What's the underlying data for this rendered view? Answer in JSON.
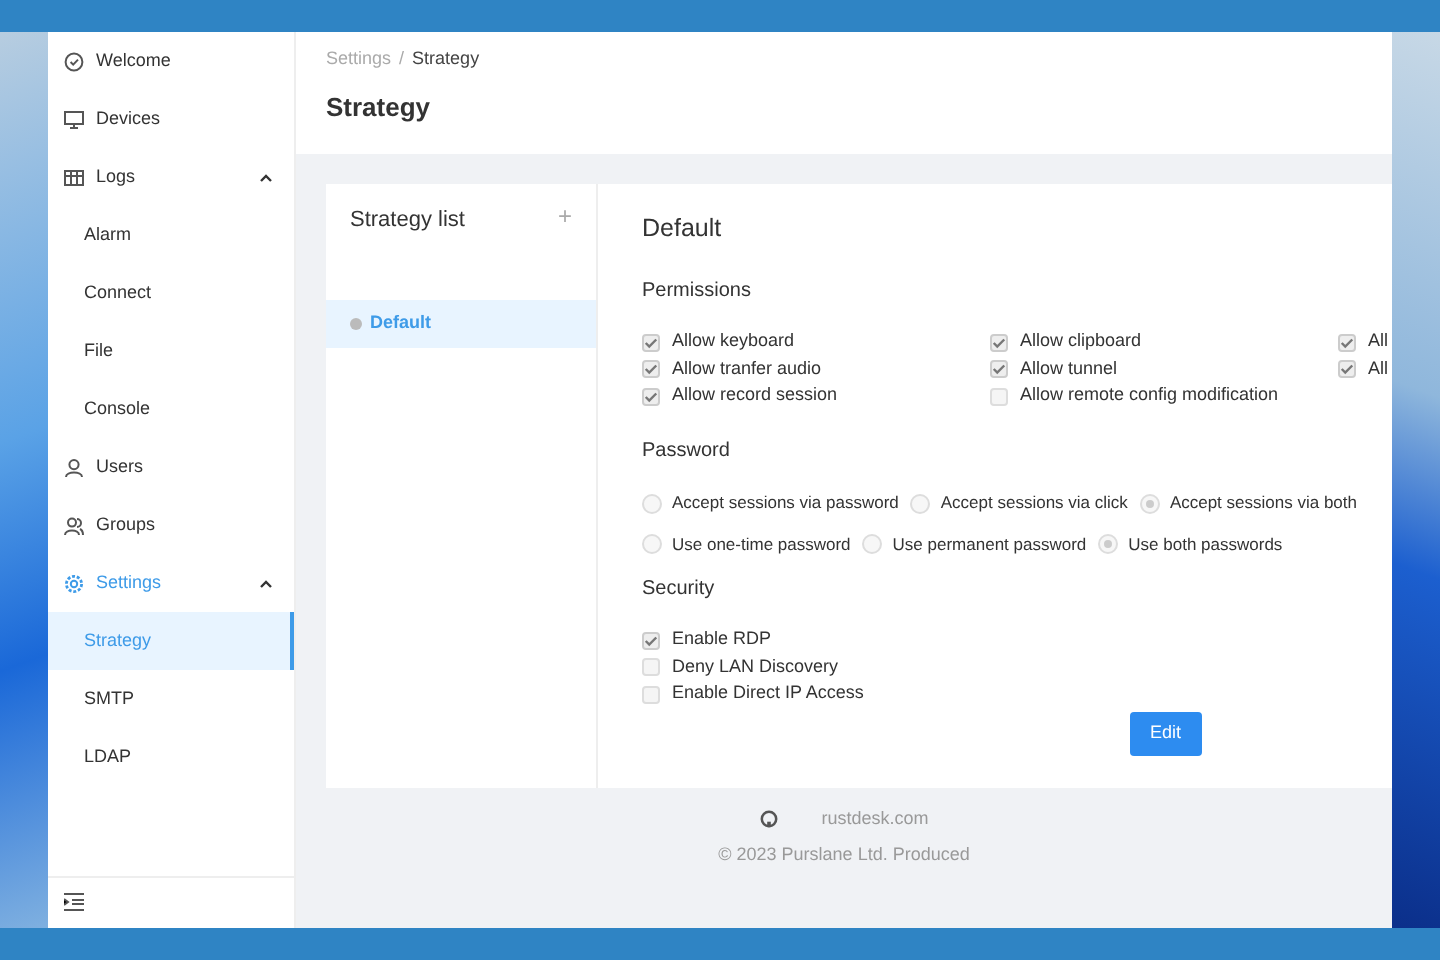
{
  "sidebar": {
    "items": [
      {
        "label": "Welcome",
        "selected": false
      },
      {
        "label": "Devices",
        "selected": false
      },
      {
        "label": "Logs",
        "selected": false,
        "expanded": true,
        "children": [
          {
            "label": "Alarm",
            "selected": false
          },
          {
            "label": "Connect",
            "selected": false
          },
          {
            "label": "File",
            "selected": false
          },
          {
            "label": "Console",
            "selected": false
          }
        ]
      },
      {
        "label": "Users",
        "selected": false
      },
      {
        "label": "Groups",
        "selected": false
      },
      {
        "label": "Settings",
        "selected": true,
        "expanded": true,
        "children": [
          {
            "label": "Strategy",
            "selected": true
          },
          {
            "label": "SMTP",
            "selected": false
          },
          {
            "label": "LDAP",
            "selected": false
          }
        ]
      }
    ]
  },
  "breadcrumb": [
    {
      "label": "Settings",
      "current": false
    },
    {
      "label": "Strategy",
      "current": true
    }
  ],
  "breadcrumb_separator": "/",
  "page_title": "Strategy",
  "strategy_list": {
    "title": "Strategy list",
    "add_icon": "+",
    "items": [
      {
        "label": "Default",
        "selected": true
      }
    ]
  },
  "strategy": {
    "title": "Default",
    "permissions": {
      "title": "Permissions",
      "columns": [
        [
          {
            "label": "Allow keyboard",
            "checked": true
          },
          {
            "label": "Allow tranfer audio",
            "checked": true
          },
          {
            "label": "Allow record session",
            "checked": true
          }
        ],
        [
          {
            "label": "Allow clipboard",
            "checked": true
          },
          {
            "label": "Allow tunnel",
            "checked": true
          },
          {
            "label": "Allow remote config modification",
            "checked": false
          }
        ],
        [
          {
            "label": "All",
            "checked": true
          },
          {
            "label": "All",
            "checked": true
          }
        ]
      ]
    },
    "password": {
      "title": "Password",
      "groups": [
        [
          {
            "label": "Accept sessions via password",
            "selected": false
          },
          {
            "label": "Accept sessions via click",
            "selected": false
          },
          {
            "label": "Accept sessions via both",
            "selected": true
          }
        ],
        [
          {
            "label": "Use one-time password",
            "selected": false
          },
          {
            "label": "Use permanent password",
            "selected": false
          },
          {
            "label": "Use both passwords",
            "selected": true
          }
        ]
      ]
    },
    "security": {
      "title": "Security",
      "items": [
        {
          "label": "Enable RDP",
          "checked": true
        },
        {
          "label": "Deny LAN Discovery",
          "checked": false
        },
        {
          "label": "Enable Direct IP Access",
          "checked": false
        }
      ]
    },
    "edit_button": "Edit"
  },
  "footer": {
    "link": "rustdesk.com",
    "copyright": "© 2023 Purslane Ltd. Produced"
  }
}
